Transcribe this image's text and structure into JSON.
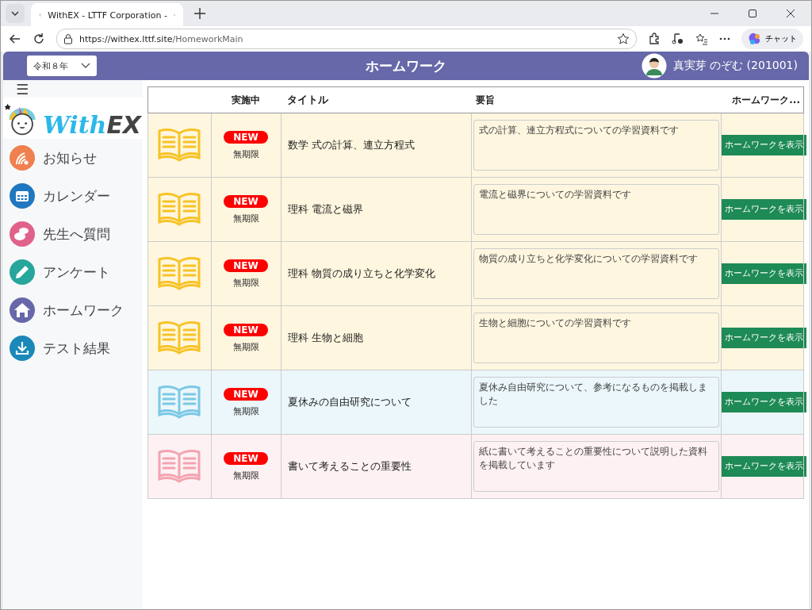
{
  "browser": {
    "tab_title": "WithEX - LTTF Corporation -",
    "url_host": "https://withex.lttf.site",
    "url_path": "/HomeworkMain",
    "copilot_label": "チャット"
  },
  "header": {
    "year_select": "令和８年",
    "title": "ホームワーク",
    "user": "真実芽 のぞむ (201001)"
  },
  "sidebar": {
    "menu_icon": "☰",
    "logo_with": "With",
    "logo_ex": "EX",
    "items": [
      {
        "label": "お知らせ",
        "kind": "feed",
        "color": "#f0804f"
      },
      {
        "label": "カレンダー",
        "kind": "calendar",
        "color": "#1f77bf"
      },
      {
        "label": "先生へ質問",
        "kind": "chat",
        "color": "#e0628a"
      },
      {
        "label": "アンケート",
        "kind": "pencil",
        "color": "#27a69b"
      },
      {
        "label": "ホームワーク",
        "kind": "home",
        "color": "#6668a9"
      },
      {
        "label": "テスト結果",
        "kind": "download",
        "color": "#1a89b8"
      }
    ]
  },
  "table": {
    "columns": [
      "実施中",
      "タイトル",
      "要旨",
      "ホームワーク..."
    ],
    "rows": [
      {
        "color": "#f7c325",
        "badge": "NEW",
        "deadline": "無期限",
        "title": "数学 式の計算、連立方程式",
        "summary": "式の計算、連立方程式についての学習資料です",
        "button": "ホームワークを表示"
      },
      {
        "color": "#f7c325",
        "badge": "NEW",
        "deadline": "無期限",
        "title": "理科 電流と磁界",
        "summary": "電流と磁界についての学習資料です",
        "button": "ホームワークを表示"
      },
      {
        "color": "#f7c325",
        "badge": "NEW",
        "deadline": "無期限",
        "title": "理科 物質の成り立ちと化学変化",
        "summary": "物質の成り立ちと化学変化についての学習資料です",
        "button": "ホームワークを表示"
      },
      {
        "color": "#f7c325",
        "badge": "NEW",
        "deadline": "無期限",
        "title": "理科 生物と細胞",
        "summary": "生物と細胞についての学習資料です",
        "button": "ホームワークを表示"
      },
      {
        "color": "#7cc8e6",
        "badge": "NEW",
        "deadline": "無期限",
        "title": "夏休みの自由研究について",
        "summary": "夏休み自由研究について、参考になるものを掲載しました",
        "button": "ホームワークを表示"
      },
      {
        "color": "#f4a3b0",
        "badge": "NEW",
        "deadline": "無期限",
        "title": "書いて考えることの重要性",
        "summary": "紙に書いて考えることの重要性について説明した資料を掲載しています",
        "button": "ホームワークを表示"
      }
    ]
  }
}
